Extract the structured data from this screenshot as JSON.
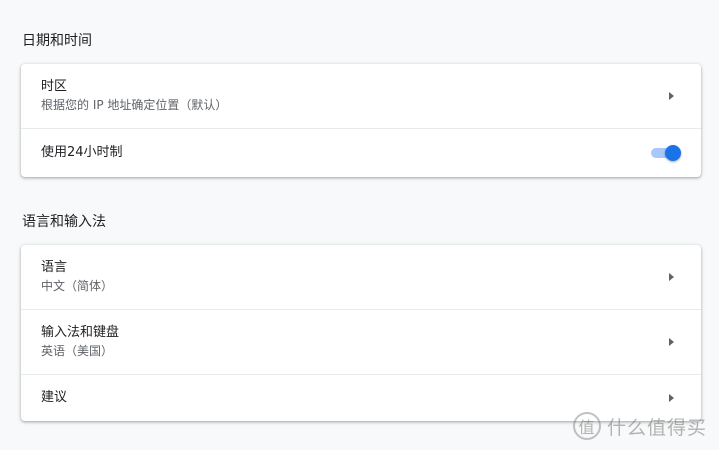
{
  "datetime_section": {
    "title": "日期和时间",
    "timezone": {
      "label": "时区",
      "sub": "根据您的 IP 地址确定位置（默认）"
    },
    "clock_24h": {
      "label": "使用24小时制",
      "enabled": true
    }
  },
  "language_section": {
    "title": "语言和输入法",
    "language": {
      "label": "语言",
      "sub": "中文（简体）"
    },
    "input_method": {
      "label": "输入法和键盘",
      "sub": "英语（美国）"
    },
    "suggestions": {
      "label": "建议"
    }
  },
  "watermark": {
    "glyph": "值",
    "text": "什么值得买"
  },
  "colors": {
    "accent": "#1a73e8",
    "toggle_track": "#a8c7fa",
    "background": "#f8f9fa"
  }
}
